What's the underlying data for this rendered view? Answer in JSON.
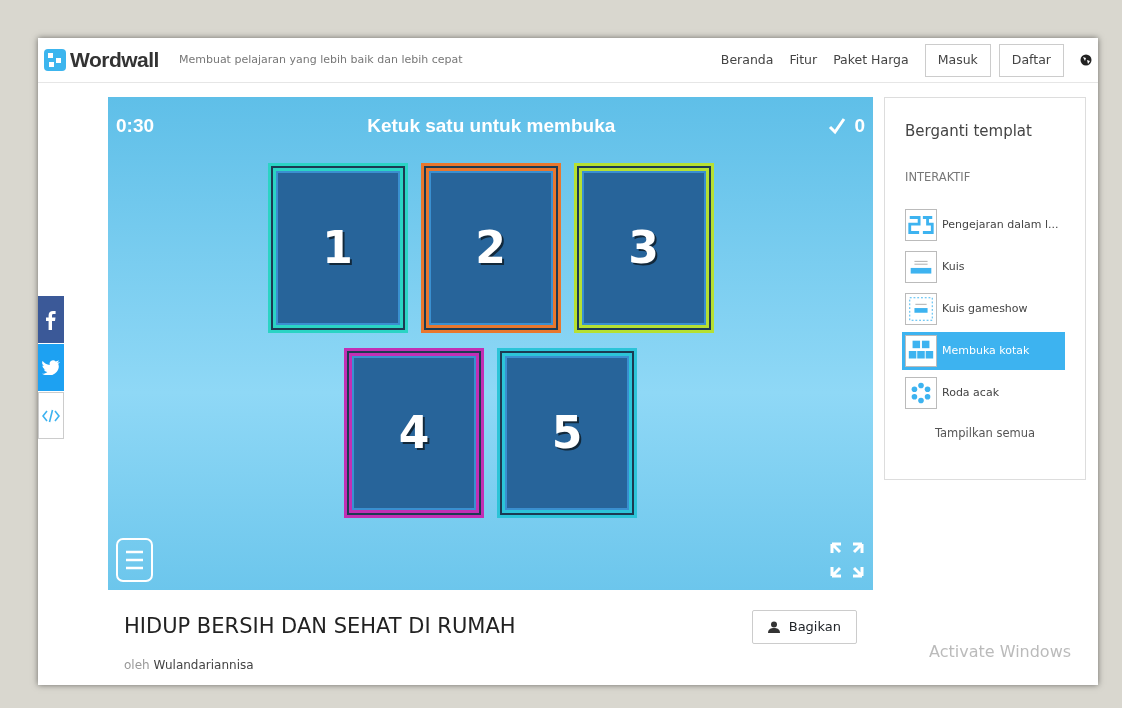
{
  "header": {
    "logo": "Wordwall",
    "tagline": "Membuat pelajaran yang lebih baik dan lebih cepat",
    "nav": [
      "Beranda",
      "Fitur",
      "Paket Harga"
    ],
    "buttons": [
      "Masuk",
      "Daftar"
    ]
  },
  "game": {
    "timer": "0:30",
    "instruction": "Ketuk satu untuk membuka",
    "score": "0",
    "tiles": [
      {
        "label": "1",
        "color": "#2bd4c4"
      },
      {
        "label": "2",
        "color": "#e8772e"
      },
      {
        "label": "3",
        "color": "#b6e032"
      },
      {
        "label": "4",
        "color": "#c22fb4"
      },
      {
        "label": "5",
        "color": "#2cc4d8"
      }
    ]
  },
  "activity": {
    "title": "HIDUP BERSIH DAN SEHAT DI RUMAH",
    "by": "oleh",
    "author": "Wulandariannisa",
    "share_button": "Bagikan"
  },
  "sidebar": {
    "title": "Berganti templat",
    "section": "INTERAKTIF",
    "items": [
      {
        "label": "Pengejaran dalam l...",
        "kind": "maze",
        "selected": false
      },
      {
        "label": "Kuis",
        "kind": "quiz",
        "selected": false
      },
      {
        "label": "Kuis gameshow",
        "kind": "gameshow",
        "selected": false
      },
      {
        "label": "Membuka kotak",
        "kind": "boxes",
        "selected": true
      },
      {
        "label": "Roda acak",
        "kind": "wheel",
        "selected": false
      }
    ],
    "show_all": "Tampilkan semua"
  },
  "os_notice": "Activate Windows"
}
